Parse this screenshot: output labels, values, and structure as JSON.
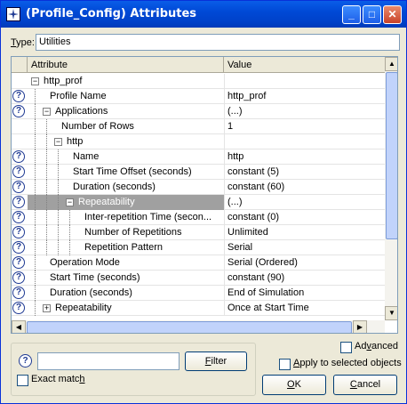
{
  "window": {
    "title": "(Profile_Config) Attributes",
    "minimize": "_",
    "maximize": "□",
    "close": "✕"
  },
  "type_field": {
    "label_prefix": "T",
    "label_rest": "ype:",
    "value": "Utilities"
  },
  "table": {
    "headers": {
      "attribute": "Attribute",
      "value": "Value"
    },
    "rows": [
      {
        "help": false,
        "name": "http_prof",
        "value": "",
        "expander": "⊟",
        "depth": 1
      },
      {
        "help": true,
        "name": "Profile Name",
        "value": "http_prof",
        "depth": 2
      },
      {
        "help": true,
        "name": "Applications",
        "value": "(...)",
        "expander": "⊟",
        "depth": 2
      },
      {
        "help": false,
        "name": "Number of Rows",
        "value": "1",
        "depth": 3
      },
      {
        "help": false,
        "name": "http",
        "value": "",
        "expander": "⊟",
        "depth": 3
      },
      {
        "help": true,
        "name": "Name",
        "value": "http",
        "depth": 4
      },
      {
        "help": true,
        "name": "Start Time Offset (seconds)",
        "value": "constant (5)",
        "depth": 4
      },
      {
        "help": true,
        "name": "Duration (seconds)",
        "value": "constant (60)",
        "depth": 4
      },
      {
        "help": true,
        "name": "Repeatability",
        "value": "(...)",
        "expander": "⊟",
        "depth": 4,
        "selected": true
      },
      {
        "help": true,
        "name": "Inter-repetition Time (secon...",
        "value": "constant (0)",
        "depth": 5
      },
      {
        "help": true,
        "name": "Number of Repetitions",
        "value": "Unlimited",
        "depth": 5
      },
      {
        "help": true,
        "name": "Repetition Pattern",
        "value": "Serial",
        "depth": 5
      },
      {
        "help": true,
        "name": "Operation Mode",
        "value": "Serial (Ordered)",
        "depth": 2
      },
      {
        "help": true,
        "name": "Start Time (seconds)",
        "value": "constant (90)",
        "depth": 2
      },
      {
        "help": true,
        "name": "Duration (seconds)",
        "value": "End of Simulation",
        "depth": 2
      },
      {
        "help": true,
        "name": "Repeatability",
        "value": "Once at Start Time",
        "expander": "⊞",
        "depth": 2
      }
    ]
  },
  "advanced": {
    "label_prefix": "Ad",
    "label_key": "v",
    "label_rest": "anced",
    "checked": false
  },
  "apply_selected": {
    "label_key": "A",
    "label_rest": "pply to selected objects",
    "checked": false
  },
  "filter": {
    "value": "",
    "button_key": "F",
    "button_rest": "ilter"
  },
  "exact_match": {
    "label_prefix": "Exact matc",
    "label_key": "h",
    "checked": false
  },
  "ok_button": {
    "key": "O",
    "rest": "K"
  },
  "cancel_button": {
    "key": "C",
    "rest": "ancel"
  }
}
